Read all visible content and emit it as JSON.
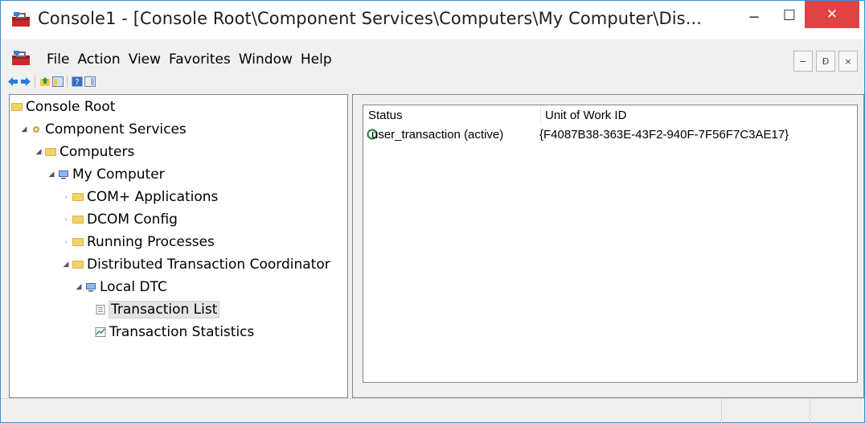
{
  "window": {
    "title": "Console1 - [Console Root\\Component Services\\Computers\\My Computer\\Dis...",
    "minimize_glyph": "−",
    "maximize_glyph": "☐",
    "close_glyph": "✕"
  },
  "menu": {
    "items": [
      "File",
      "Action",
      "View",
      "Favorites",
      "Window",
      "Help"
    ]
  },
  "mdi_controls": [
    "−",
    "Ɖ",
    "×"
  ],
  "toolbar": {
    "icons": [
      "back-icon",
      "forward-icon",
      "up-folder-icon",
      "show-hide-tree-icon",
      "help-icon",
      "action-pane-icon"
    ]
  },
  "tree": {
    "items": [
      {
        "label": "Console Root",
        "icon": "folder-icon",
        "expander": ""
      },
      {
        "label": "Component Services",
        "icon": "component-services-icon",
        "expander": "◢"
      },
      {
        "label": "Computers",
        "icon": "folder-icon",
        "expander": "◢"
      },
      {
        "label": "My Computer",
        "icon": "computer-icon",
        "expander": "◢"
      },
      {
        "label": "COM+ Applications",
        "icon": "folder-icon",
        "expander": "›"
      },
      {
        "label": "DCOM Config",
        "icon": "folder-icon",
        "expander": "›"
      },
      {
        "label": "Running Processes",
        "icon": "folder-icon",
        "expander": "›"
      },
      {
        "label": "Distributed Transaction Coordinator",
        "icon": "folder-icon",
        "expander": "◢"
      },
      {
        "label": "Local DTC",
        "icon": "computer-icon",
        "expander": "◢"
      },
      {
        "label": "Transaction List",
        "icon": "list-icon",
        "expander": "",
        "selected": true
      },
      {
        "label": "Transaction Statistics",
        "icon": "statistics-icon",
        "expander": ""
      }
    ]
  },
  "list": {
    "columns": [
      "Status",
      "Unit of Work ID"
    ],
    "rows": [
      {
        "status": "user_transaction (active)",
        "uow_id": "{F4087B38-363E-43F2-940F-7F56F7C3AE17}",
        "icon": "transaction-active-icon"
      }
    ]
  },
  "colors": {
    "close_button": "#e04343",
    "window_border": "#3c8ed6",
    "folder": "#f2d36b"
  }
}
